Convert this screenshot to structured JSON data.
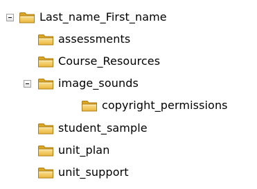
{
  "tree": {
    "root": {
      "label": "Last_name_First_name",
      "expanded": true,
      "icon": "folder-icon"
    },
    "children": [
      {
        "label": "assessments",
        "icon": "folder-icon"
      },
      {
        "label": "Course_Resources",
        "icon": "folder-icon"
      },
      {
        "label": "image_sounds",
        "icon": "folder-icon",
        "expanded": true
      },
      {
        "label": "copyright_permissions",
        "icon": "folder-icon"
      },
      {
        "label": "student_sample",
        "icon": "folder-icon"
      },
      {
        "label": "unit_plan",
        "icon": "folder-icon"
      },
      {
        "label": "unit_support",
        "icon": "folder-icon"
      }
    ]
  },
  "colors": {
    "folder_body": "#f2c84b",
    "folder_back": "#d9a524",
    "folder_outline": "#b07d12",
    "toggle_border": "#a0a0a0"
  }
}
